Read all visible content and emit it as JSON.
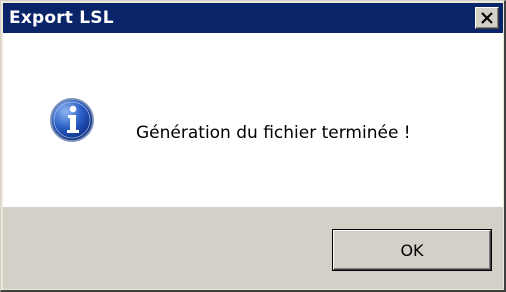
{
  "window": {
    "title": "Export LSL"
  },
  "titlebar": {
    "close_icon": "close-icon"
  },
  "message": {
    "icon": "info-icon",
    "text": "Génération du fichier terminée !"
  },
  "buttons": {
    "ok_label": "OK"
  },
  "colors": {
    "titlebar": "#0a246a",
    "title_text": "#ffffff",
    "content_bg": "#ffffff",
    "footer_bg": "#d4d0c8",
    "icon_blue": "#1b4fb5"
  }
}
